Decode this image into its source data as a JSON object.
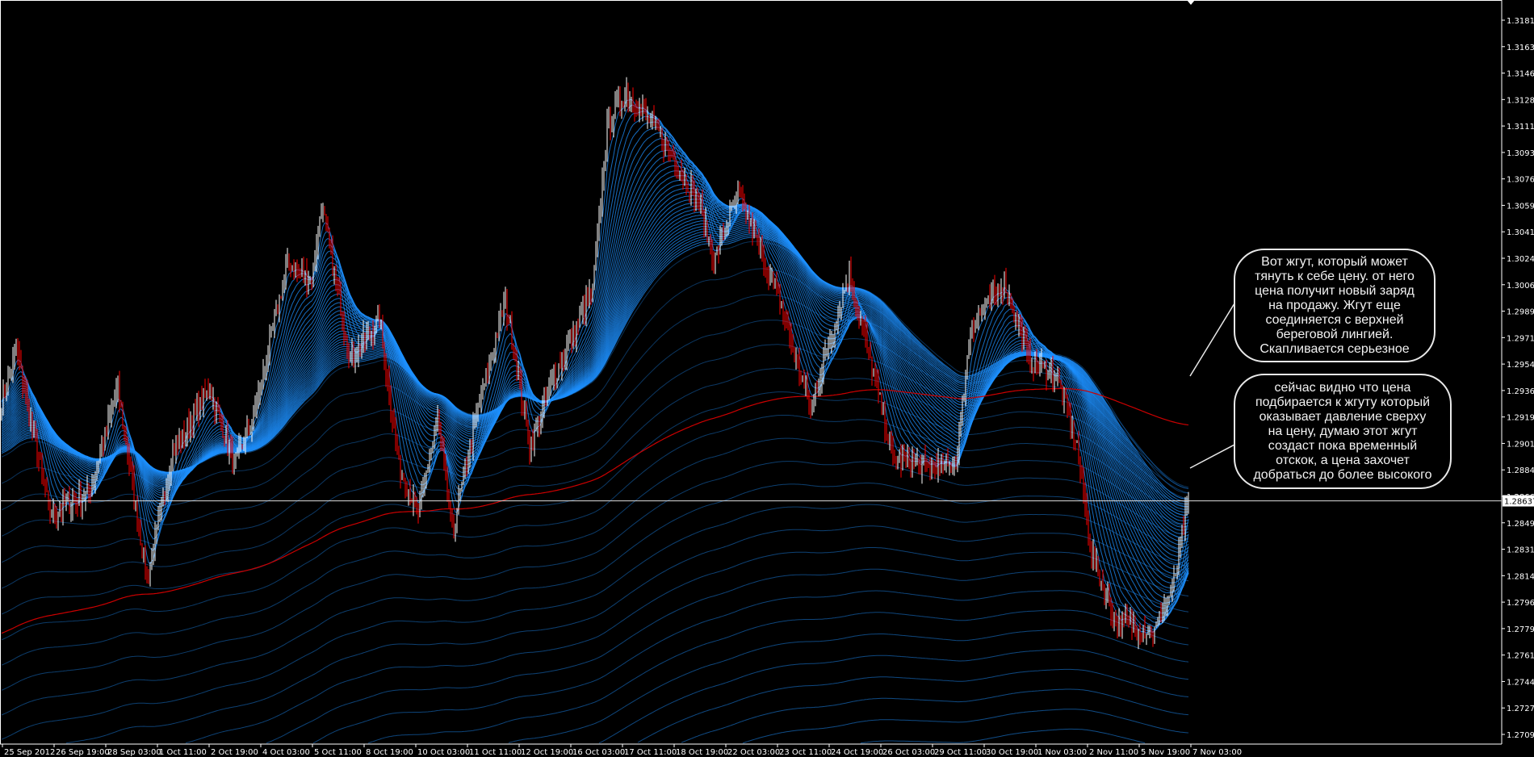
{
  "chart_data": {
    "type": "candlestick",
    "symbol_timeframe": "H1",
    "ylim": [
      1.2708,
      1.3196
    ],
    "price_ticks": [
      "1.31810",
      "1.31635",
      "1.31460",
      "1.31285",
      "1.31110",
      "1.30935",
      "1.30760",
      "1.30590",
      "1.30415",
      "1.30240",
      "1.30065",
      "1.29890",
      "1.29715",
      "1.29540",
      "1.29365",
      "1.29190",
      "1.29015",
      "1.28840",
      "1.28665",
      "1.28490",
      "1.28315",
      "1.28140",
      "1.27965",
      "1.27790",
      "1.27615",
      "1.27445",
      "1.27270",
      "1.27095"
    ],
    "time_ticks": [
      "25 Sep 2012",
      "26 Sep 19:00",
      "28 Sep 03:00",
      "1 Oct 11:00",
      "2 Oct 19:00",
      "4 Oct 03:00",
      "5 Oct 11:00",
      "8 Oct 19:00",
      "10 Oct 03:00",
      "11 Oct 11:00",
      "12 Oct 19:00",
      "16 Oct 03:00",
      "17 Oct 11:00",
      "18 Oct 19:00",
      "22 Oct 03:00",
      "23 Oct 11:00",
      "24 Oct 19:00",
      "26 Oct 03:00",
      "29 Oct 11:00",
      "30 Oct 19:00",
      "1 Nov 03:00",
      "2 Nov 11:00",
      "5 Nov 19:00",
      "7 Nov 03:00"
    ],
    "bars_per_time_tick": 32,
    "current_price": "1.28637",
    "close_path": [
      [
        0,
        1.293
      ],
      [
        3,
        1.2938
      ],
      [
        9,
        1.2964
      ],
      [
        30,
        1.2855
      ],
      [
        54,
        1.2868
      ],
      [
        72,
        1.2938
      ],
      [
        90,
        1.281
      ],
      [
        105,
        1.2893
      ],
      [
        129,
        1.2938
      ],
      [
        144,
        1.2887
      ],
      [
        156,
        1.2919
      ],
      [
        177,
        1.3021
      ],
      [
        192,
        1.3009
      ],
      [
        198,
        1.306
      ],
      [
        216,
        1.2957
      ],
      [
        234,
        1.2983
      ],
      [
        246,
        1.2887
      ],
      [
        258,
        1.2855
      ],
      [
        270,
        1.2919
      ],
      [
        279,
        1.2842
      ],
      [
        294,
        1.2919
      ],
      [
        312,
        1.2996
      ],
      [
        327,
        1.29
      ],
      [
        342,
        1.2945
      ],
      [
        366,
        1.3002
      ],
      [
        375,
        1.3111
      ],
      [
        387,
        1.3134
      ],
      [
        408,
        1.3105
      ],
      [
        432,
        1.306
      ],
      [
        441,
        1.3021
      ],
      [
        456,
        1.3066
      ],
      [
        480,
        1.3002
      ],
      [
        501,
        1.2925
      ],
      [
        525,
        1.3015
      ],
      [
        552,
        1.2893
      ],
      [
        570,
        1.2887
      ],
      [
        591,
        1.2887
      ],
      [
        600,
        1.2977
      ],
      [
        621,
        1.3009
      ],
      [
        636,
        1.2957
      ],
      [
        654,
        1.2945
      ],
      [
        666,
        1.29
      ],
      [
        675,
        1.2829
      ],
      [
        690,
        1.2784
      ],
      [
        714,
        1.2778
      ],
      [
        726,
        1.281
      ],
      [
        735,
        1.2864
      ]
    ],
    "colors": {
      "bull": "#ffffff",
      "bear": "#ff0000",
      "ribbon": "#1e90ff",
      "slow_ma": "#cc0000",
      "background": "#000000",
      "axis": "#ffffff"
    }
  },
  "callouts": [
    {
      "lines": [
        "Вот жгут, который может",
        "тянуть к себе цену. от него",
        "цена получит новый заряд",
        "на продажу. Жгут еще",
        "соединяется с верхней",
        "береговой лингией.",
        "Скапливается серьезное"
      ]
    },
    {
      "lines": [
        "сейчас видно что цена",
        "подбирается к жгуту который",
        "оказывает давление сверху",
        "на цену, думаю этот жгут",
        "создаст пока временный",
        "отскок, а цена захочет",
        "добраться до более высокого"
      ]
    }
  ]
}
